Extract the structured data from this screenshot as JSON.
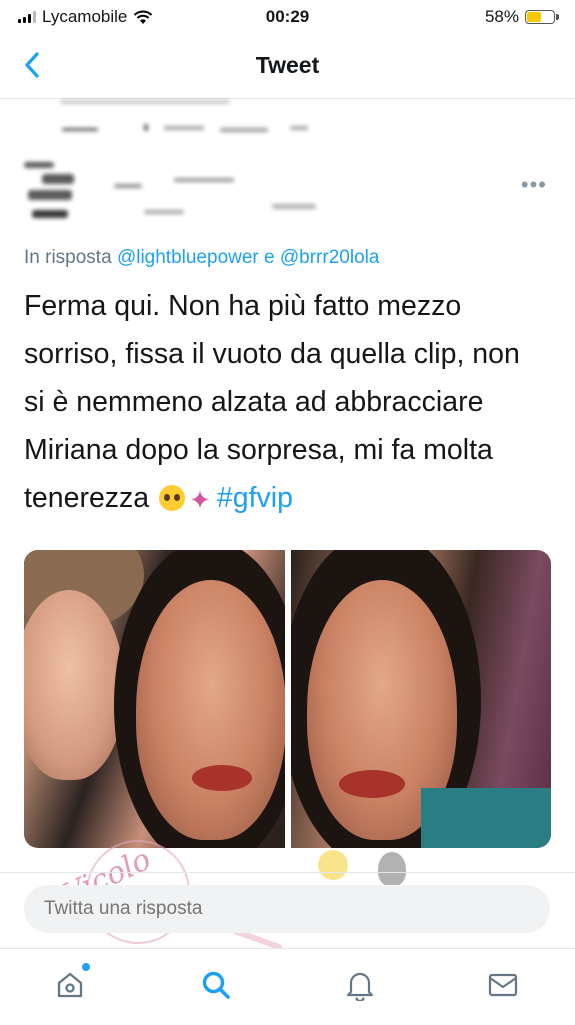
{
  "status_bar": {
    "carrier": "Lycamobile",
    "time": "00:29",
    "battery_percent": "58%",
    "battery_level": 0.58,
    "accent": "#f5c800"
  },
  "nav": {
    "title": "Tweet",
    "back_icon": "chevron-left-icon",
    "accent": "#1da1f2"
  },
  "tweet": {
    "reply_prefix": "In risposta",
    "reply_handles": "@lightbluepower e @brrr20lola",
    "text_lines": [
      "Ferma qui. Non ha più fatto mezzo",
      "sorriso, fissa il vuoto da quella clip, non",
      "si è nemmeno alzata ad abbracciare",
      "Miriana dopo la sorpresa, mi fa molta",
      "tenerezza"
    ],
    "emojis": [
      "pleading-face-emoji",
      "fairy-emoji"
    ],
    "hashtag": "#gfvip",
    "more_icon": "more-horizontal-icon"
  },
  "media": {
    "images": [
      {
        "name": "tweet-photo-left"
      },
      {
        "name": "tweet-photo-right"
      }
    ]
  },
  "reply_box": {
    "placeholder": "Twitta una risposta"
  },
  "tab_bar": {
    "items": [
      {
        "name": "home",
        "icon": "home-icon",
        "notification": true
      },
      {
        "name": "search",
        "icon": "search-icon",
        "active": true
      },
      {
        "name": "notifications",
        "icon": "bell-icon"
      },
      {
        "name": "messages",
        "icon": "mail-icon"
      }
    ]
  },
  "watermark": {
    "text": "Vicolo delle News"
  }
}
